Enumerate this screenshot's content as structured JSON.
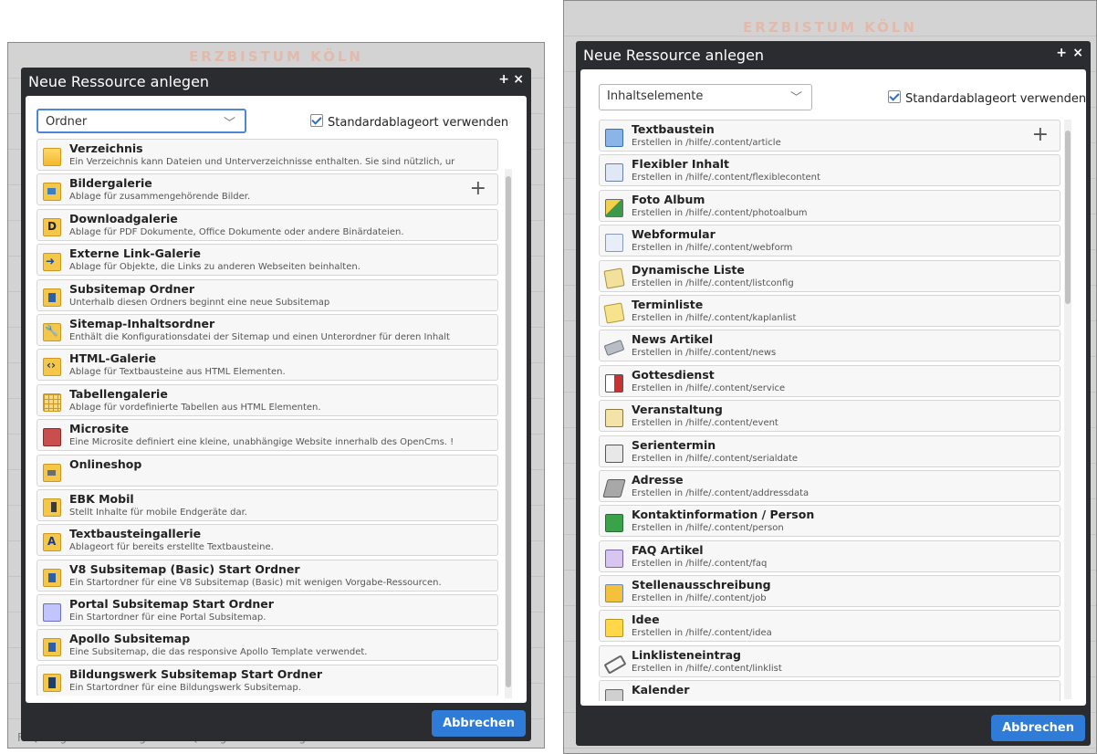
{
  "left": {
    "brand": "ERZBISTUM KÖLN",
    "footer_text": "FAQ Vergabe von Kategorien   FAQ Vergabe von Kategorien für News",
    "dialog": {
      "title": "Neue Ressource anlegen",
      "plus": "+",
      "close": "×",
      "type_select": "Ordner",
      "checkbox_label": "Standardablageort verwenden",
      "cancel_label": "Abbrechen",
      "add_symbol": "+",
      "items": [
        {
          "title": "Verzeichnis",
          "desc": "Ein Verzeichnis kann Dateien und Unterverzeichnisse enthalten. Sie sind nützlich, ur"
        },
        {
          "title": "Bildergalerie",
          "desc": "Ablage für zusammengehörende Bilder."
        },
        {
          "title": "Downloadgalerie",
          "desc": "Ablage für PDF Dokumente, Office Dokumente oder andere Binärdateien."
        },
        {
          "title": "Externe Link-Galerie",
          "desc": "Ablage für Objekte, die Links zu anderen Webseiten beinhalten."
        },
        {
          "title": "Subsitemap Ordner",
          "desc": "Unterhalb diesen Ordners beginnt eine neue Subsitemap"
        },
        {
          "title": "Sitemap-Inhaltsordner",
          "desc": "Enthält die Konfigurationsdatei der Sitemap und einen Unterordner für deren Inhalt"
        },
        {
          "title": "HTML-Galerie",
          "desc": "Ablage für Textbausteine aus HTML Elementen."
        },
        {
          "title": "Tabellengalerie",
          "desc": "Ablage für vordefinierte Tabellen aus HTML Elementen."
        },
        {
          "title": "Microsite",
          "desc": "Eine Microsite definiert eine kleine, unabhängige Website innerhalb des OpenCms. !"
        },
        {
          "title": "Onlineshop",
          "desc": ""
        },
        {
          "title": "EBK Mobil",
          "desc": "Stellt Inhalte für mobile Endgeräte dar."
        },
        {
          "title": "Textbausteingallerie",
          "desc": "Ablageort für bereits erstellte Textbausteine."
        },
        {
          "title": "V8 Subsitemap (Basic) Start Ordner",
          "desc": "Ein Startordner für eine V8 Subsitemap (Basic) mit wenigen Vorgabe-Ressourcen."
        },
        {
          "title": "Portal Subsitemap Start Ordner",
          "desc": "Ein Startordner für eine Portal Subsitemap."
        },
        {
          "title": "Apollo Subsitemap",
          "desc": "Eine Subsitemap, die das responsive Apollo Template verwendet."
        },
        {
          "title": "Bildungswerk Subsitemap Start Ordner",
          "desc": "Ein Startordner für eine Bildungswerk Subsitemap."
        }
      ]
    }
  },
  "right": {
    "brand": "ERZBISTUM KÖLN",
    "dialog": {
      "title": "Neue Ressource anlegen",
      "plus": "+",
      "close": "×",
      "type_select": "Inhaltselemente",
      "checkbox_label": "Standardablageort verwenden",
      "cancel_label": "Abbrechen",
      "add_symbol": "+",
      "items": [
        {
          "title": "Textbaustein",
          "desc": "Erstellen in /hilfe/.content/article"
        },
        {
          "title": "Flexibler Inhalt",
          "desc": "Erstellen in /hilfe/.content/flexiblecontent"
        },
        {
          "title": "Foto Album",
          "desc": "Erstellen in /hilfe/.content/photoalbum"
        },
        {
          "title": "Webformular",
          "desc": "Erstellen in /hilfe/.content/webform"
        },
        {
          "title": "Dynamische Liste",
          "desc": "Erstellen in /hilfe/.content/listconfig"
        },
        {
          "title": "Terminliste",
          "desc": "Erstellen in /hilfe/.content/kaplanlist"
        },
        {
          "title": "News Artikel",
          "desc": "Erstellen in /hilfe/.content/news"
        },
        {
          "title": "Gottesdienst",
          "desc": "Erstellen in /hilfe/.content/service"
        },
        {
          "title": "Veranstaltung",
          "desc": "Erstellen in /hilfe/.content/event"
        },
        {
          "title": "Serientermin",
          "desc": "Erstellen in /hilfe/.content/serialdate"
        },
        {
          "title": "Adresse",
          "desc": "Erstellen in /hilfe/.content/addressdata"
        },
        {
          "title": "Kontaktinformation / Person",
          "desc": "Erstellen in /hilfe/.content/person"
        },
        {
          "title": "FAQ Artikel",
          "desc": "Erstellen in /hilfe/.content/faq"
        },
        {
          "title": "Stellenausschreibung",
          "desc": "Erstellen in /hilfe/.content/job"
        },
        {
          "title": "Idee",
          "desc": "Erstellen in /hilfe/.content/idea"
        },
        {
          "title": "Linklisteneintrag",
          "desc": "Erstellen in /hilfe/.content/linklist"
        },
        {
          "title": "Kalender",
          "desc": ""
        }
      ]
    }
  }
}
